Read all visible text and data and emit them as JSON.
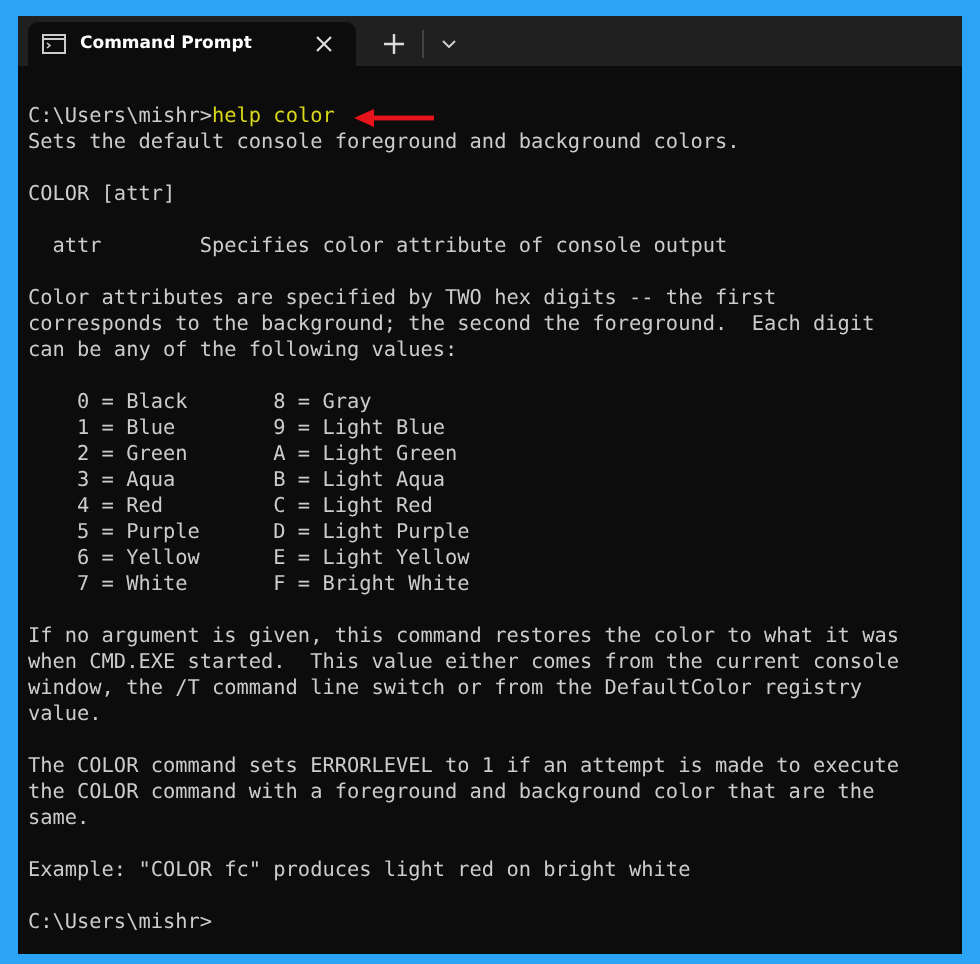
{
  "tabs": [
    {
      "title": "Command Prompt",
      "selected": true
    }
  ],
  "console": {
    "lines": [
      {
        "kind": "command",
        "prompt": "C:\\Users\\mishr>",
        "command": "help color",
        "arrow": true
      },
      {
        "kind": "text",
        "text": "Sets the default console foreground and background colors."
      },
      {
        "kind": "blank"
      },
      {
        "kind": "text",
        "text": "COLOR [attr]"
      },
      {
        "kind": "blank"
      },
      {
        "kind": "text",
        "text": "  attr        Specifies color attribute of console output"
      },
      {
        "kind": "blank"
      },
      {
        "kind": "text",
        "text": "Color attributes are specified by TWO hex digits -- the first"
      },
      {
        "kind": "text",
        "text": "corresponds to the background; the second the foreground.  Each digit"
      },
      {
        "kind": "text",
        "text": "can be any of the following values:"
      },
      {
        "kind": "blank"
      },
      {
        "kind": "text",
        "text": "    0 = Black       8 = Gray"
      },
      {
        "kind": "text",
        "text": "    1 = Blue        9 = Light Blue"
      },
      {
        "kind": "text",
        "text": "    2 = Green       A = Light Green"
      },
      {
        "kind": "text",
        "text": "    3 = Aqua        B = Light Aqua"
      },
      {
        "kind": "text",
        "text": "    4 = Red         C = Light Red"
      },
      {
        "kind": "text",
        "text": "    5 = Purple      D = Light Purple"
      },
      {
        "kind": "text",
        "text": "    6 = Yellow      E = Light Yellow"
      },
      {
        "kind": "text",
        "text": "    7 = White       F = Bright White"
      },
      {
        "kind": "blank"
      },
      {
        "kind": "text",
        "text": "If no argument is given, this command restores the color to what it was"
      },
      {
        "kind": "text",
        "text": "when CMD.EXE started.  This value either comes from the current console"
      },
      {
        "kind": "text",
        "text": "window, the /T command line switch or from the DefaultColor registry"
      },
      {
        "kind": "text",
        "text": "value."
      },
      {
        "kind": "blank"
      },
      {
        "kind": "text",
        "text": "The COLOR command sets ERRORLEVEL to 1 if an attempt is made to execute"
      },
      {
        "kind": "text",
        "text": "the COLOR command with a foreground and background color that are the"
      },
      {
        "kind": "text",
        "text": "same."
      },
      {
        "kind": "blank"
      },
      {
        "kind": "text",
        "text": "Example: \"COLOR fc\" produces light red on bright white"
      },
      {
        "kind": "blank"
      },
      {
        "kind": "prompt",
        "prompt": "C:\\Users\\mishr>"
      }
    ]
  }
}
